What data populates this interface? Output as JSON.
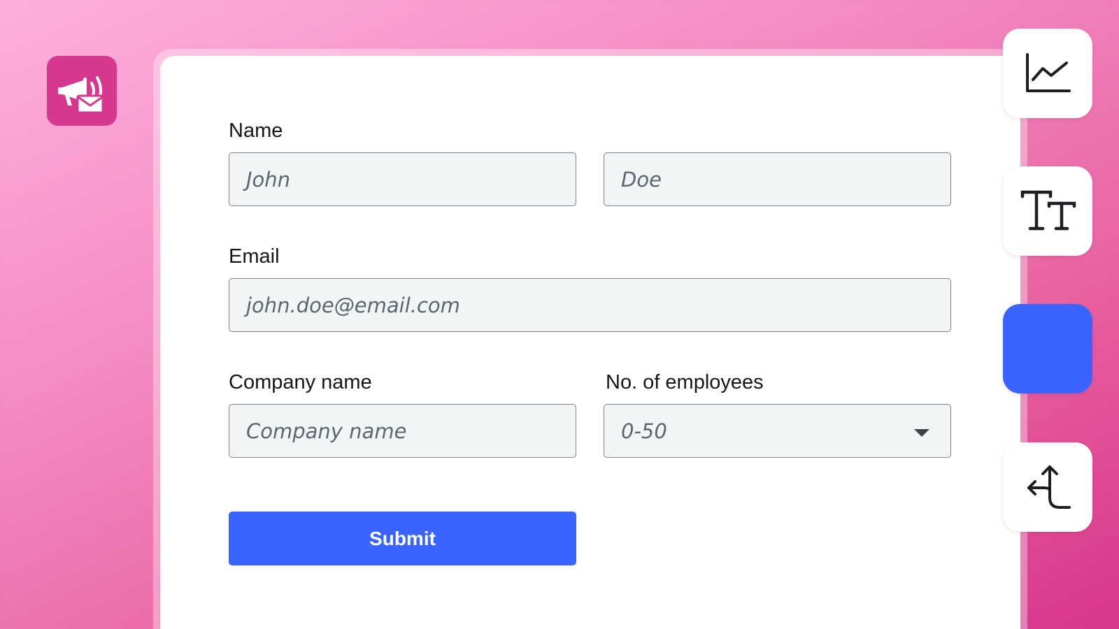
{
  "form": {
    "name_label": "Name",
    "first_name_placeholder": "John",
    "last_name_placeholder": "Doe",
    "email_label": "Email",
    "email_placeholder": "john.doe@email.com",
    "company_label": "Company name",
    "company_placeholder": "Company name",
    "employees_label": "No. of employees",
    "employees_selected": "0-50",
    "submit_label": "Submit"
  },
  "toolbar": {
    "items": [
      {
        "icon": "chart-icon"
      },
      {
        "icon": "text-size-icon"
      },
      {
        "icon": "color-swatch",
        "color": "#3a63ff"
      },
      {
        "icon": "branch-arrow-icon"
      }
    ]
  },
  "logo": {
    "icon": "megaphone-mail-icon",
    "color": "#d6388e"
  },
  "colors": {
    "accent": "#3a63ff",
    "brand": "#d6388e"
  }
}
